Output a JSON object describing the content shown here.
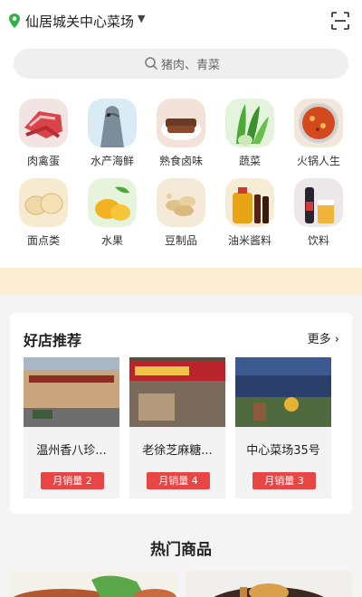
{
  "header": {
    "location": "仙居城关中心菜场"
  },
  "search": {
    "placeholder": "猪肉、青菜"
  },
  "categories": [
    {
      "label": "肉禽蛋",
      "icon": "meat-icon"
    },
    {
      "label": "水产海鲜",
      "icon": "fish-icon"
    },
    {
      "label": "熟食卤味",
      "icon": "braised-meat-icon"
    },
    {
      "label": "蔬菜",
      "icon": "vegetable-icon"
    },
    {
      "label": "火锅人生",
      "icon": "hotpot-icon"
    },
    {
      "label": "面点类",
      "icon": "bread-icon"
    },
    {
      "label": "水果",
      "icon": "mango-icon"
    },
    {
      "label": "豆制品",
      "icon": "soybean-icon"
    },
    {
      "label": "油米酱料",
      "icon": "oil-bottle-icon"
    },
    {
      "label": "饮料",
      "icon": "beer-icon"
    }
  ],
  "recommend": {
    "title": "好店推荐",
    "more": "更多",
    "shops": [
      {
        "name": "温州香八珍...",
        "badge": "月销量 2"
      },
      {
        "name": "老徐芝麻糖...",
        "badge": "月销量 4"
      },
      {
        "name": "中心菜场35号",
        "badge": "月销量 3"
      }
    ]
  },
  "hot": {
    "title": "热门商品"
  },
  "colors": {
    "brand_green": "#2eb24a",
    "badge_red": "#e84545",
    "banner": "#fbeed2"
  }
}
